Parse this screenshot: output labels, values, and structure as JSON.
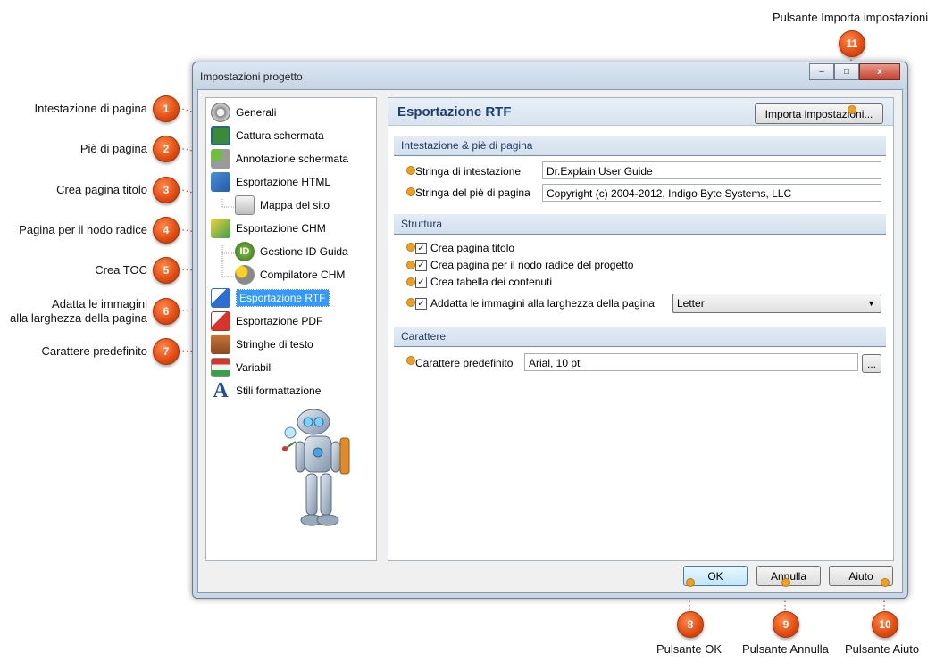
{
  "annotations": {
    "a1": {
      "num": "1",
      "label": "Intestazione di pagina"
    },
    "a2": {
      "num": "2",
      "label": "Piè di pagina"
    },
    "a3": {
      "num": "3",
      "label": "Crea pagina titolo"
    },
    "a4": {
      "num": "4",
      "label": "Pagina per il nodo radice"
    },
    "a5": {
      "num": "5",
      "label": "Crea TOC"
    },
    "a6": {
      "num": "6",
      "label_line1": "Adatta le immagini",
      "label_line2": "alla larghezza della pagina"
    },
    "a7": {
      "num": "7",
      "label": "Carattere predefinito"
    },
    "a8": {
      "num": "8",
      "label": "Pulsante OK"
    },
    "a9": {
      "num": "9",
      "label": "Pulsante Annulla"
    },
    "a10": {
      "num": "10",
      "label": "Pulsante Aiuto"
    },
    "a11": {
      "num": "11",
      "label": "Pulsante Importa impostazioni"
    }
  },
  "window": {
    "title": "Impostazioni progetto",
    "minimize": "–",
    "maximize": "□",
    "close": "x"
  },
  "nav": {
    "items": [
      {
        "label": "Generali",
        "icon": "gear-icon"
      },
      {
        "label": "Cattura schermata",
        "icon": "capture-icon"
      },
      {
        "label": "Annotazione schermata",
        "icon": "annotation-icon"
      },
      {
        "label": "Esportazione HTML",
        "icon": "html-export-icon"
      },
      {
        "label": "Mappa del sito",
        "icon": "sitemap-icon"
      },
      {
        "label": "Esportazione CHM",
        "icon": "chm-export-icon"
      },
      {
        "label": "Gestione ID Guida",
        "icon": "id-icon"
      },
      {
        "label": "Compilatore CHM",
        "icon": "compiler-icon"
      },
      {
        "label": "Esportazione RTF",
        "icon": "rtf-export-icon"
      },
      {
        "label": "Esportazione PDF",
        "icon": "pdf-export-icon"
      },
      {
        "label": "Stringhe di testo",
        "icon": "text-strings-icon"
      },
      {
        "label": "Variabili",
        "icon": "variables-icon"
      },
      {
        "label": "Stili formattazione",
        "icon": "styles-icon"
      }
    ],
    "selected": "Esportazione RTF"
  },
  "panel": {
    "title": "Esportazione RTF",
    "import_button": "Importa impostazioni...",
    "section_header": "Intestazione & piè di pagina",
    "header_label": "Stringa di intestazione",
    "header_value": "Dr.Explain User Guide",
    "footer_label": "Stringa del piè di pagina",
    "footer_value": "Copyright (c) 2004-2012, Indigo Byte Systems, LLC",
    "section_structure": "Struttura",
    "chk_title": "Crea pagina titolo",
    "chk_root": "Crea pagina per il nodo radice del progetto",
    "chk_toc": "Crea tabella dei contenuti",
    "chk_fit": "Addatta le immagini alla larghezza della pagina",
    "page_size": "Letter",
    "section_font": "Carattere",
    "font_label": "Carattere predefinito",
    "font_value": "Arial, 10 pt",
    "font_browse": "..."
  },
  "checks": {
    "mark": "✓"
  },
  "footer": {
    "ok": "OK",
    "cancel": "Annulla",
    "help": "Aiuto"
  },
  "colors": {
    "badge": "#e04a10",
    "leader": "#e0502a",
    "selection": "#3399ff",
    "panel_title": "#1d3e6e"
  }
}
